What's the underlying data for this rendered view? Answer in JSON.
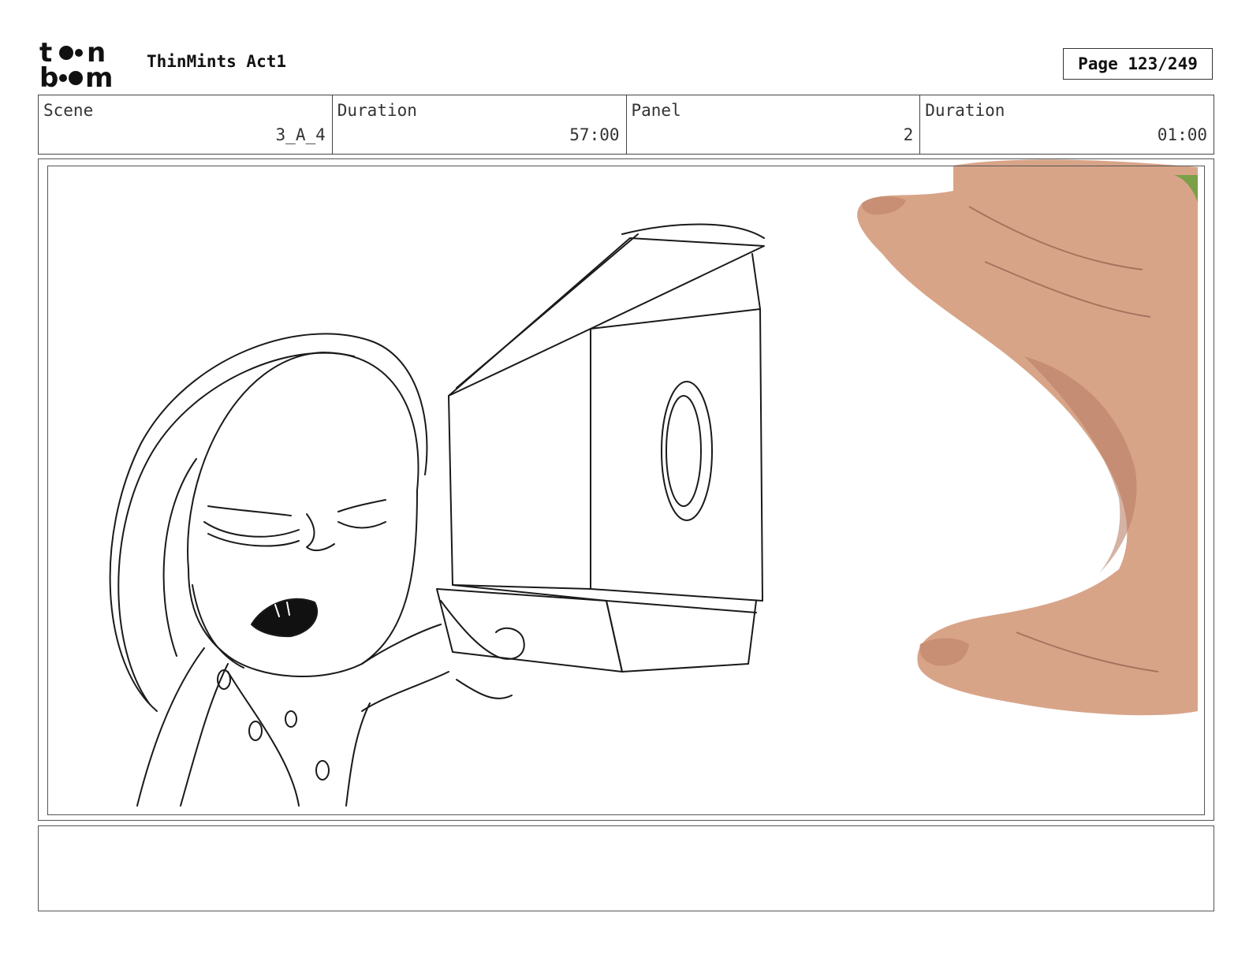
{
  "header": {
    "logo_text": "toon boom",
    "title": "ThinMints Act1",
    "page_label": "Page 123/249"
  },
  "info": [
    {
      "label": "Scene",
      "value": "3_A_4"
    },
    {
      "label": "Duration",
      "value": "57:00"
    },
    {
      "label": "Panel",
      "value": "2"
    },
    {
      "label": "Duration",
      "value": "01:00"
    }
  ],
  "panel": {
    "description": "pencil sketch of a character pointing a large box-shaped gun, with a photographed hand on the right"
  },
  "notes": {
    "text": ""
  },
  "colors": {
    "sketch_line": "#1a1a1a",
    "skin": "#d9a58a",
    "border": "#555555"
  }
}
